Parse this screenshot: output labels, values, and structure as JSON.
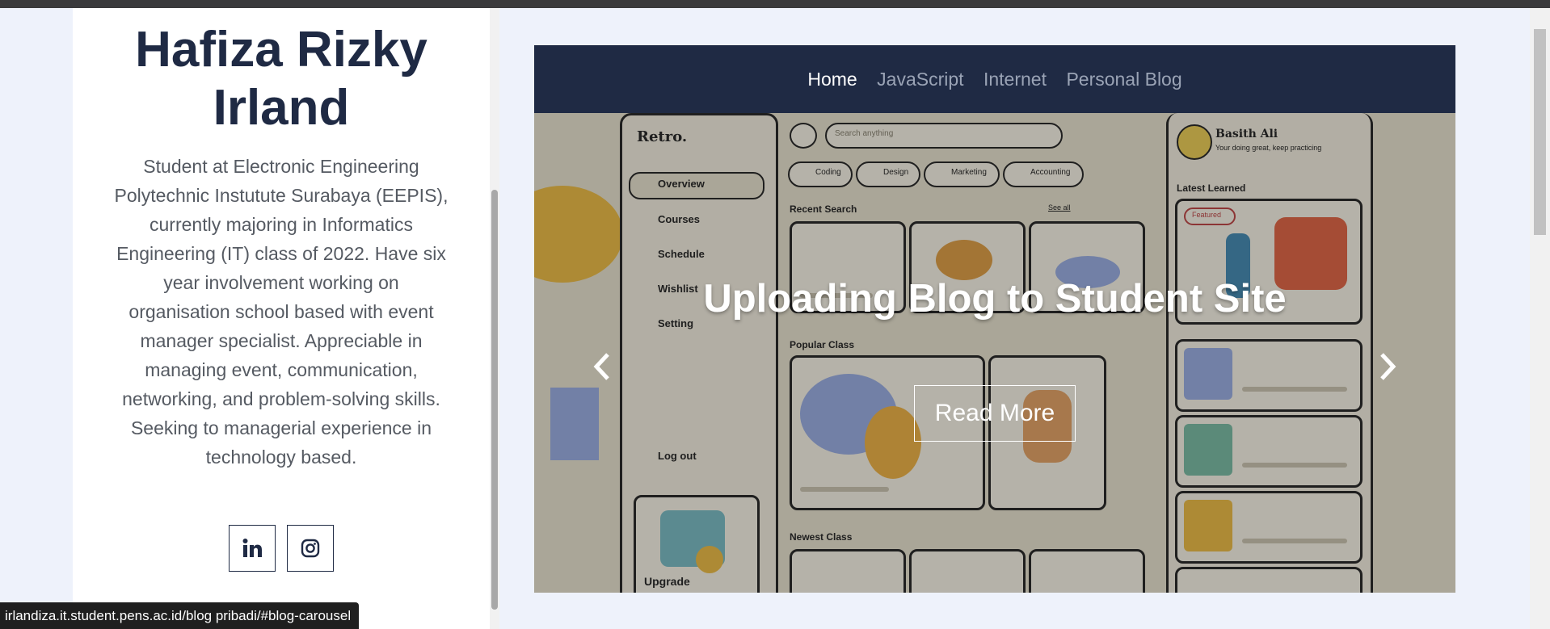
{
  "profile": {
    "name": "Hafiza Rizky Irland",
    "bio": "Student at Electronic Engineering Polytechnic Instutute Surabaya (EEPIS), currently majoring in Informatics Engineering (IT) class of 2022. Have six year involvement working on organisation school based with event manager specialist. Appreciable in managing event, communication, networking, and problem-solving skills. Seeking to managerial experience in technology based.",
    "socials": [
      {
        "icon": "linkedin-icon",
        "label": "in"
      },
      {
        "icon": "instagram-icon"
      }
    ]
  },
  "blog": {
    "nav": [
      "Home",
      "JavaScript",
      "Internet",
      "Personal Blog"
    ],
    "active_nav": "Home",
    "slide_caption": "Uploading Blog to Student Site",
    "read_more_label": "Read More",
    "prev_icon": "chevron-left-icon",
    "next_icon": "chevron-right-icon",
    "mockup": {
      "app_name": "Retro.",
      "menu": [
        "Overview",
        "Courses",
        "Schedule",
        "Wishlist",
        "Setting"
      ],
      "logout": "Log out",
      "search_placeholder": "Search anything",
      "categories": [
        "Coding",
        "Design",
        "Marketing",
        "Accounting"
      ],
      "see_all": "See all",
      "recent_search": "Recent Search",
      "popular_class": "Popular Class",
      "newest_class": "Newest Class",
      "user_name": "Basith Ali",
      "user_status": "Your doing great, keep practicing",
      "latest_learned": "Latest Learned",
      "featured_tag": "Featured",
      "upgrade": "Upgrade"
    }
  },
  "status_url": "irlandiza.it.student.pens.ac.id/blog pribadi/#blog-carousel",
  "colors": {
    "navy": "#1f2a44",
    "page_bg": "#eef2fb",
    "bio_text": "#555a62"
  }
}
